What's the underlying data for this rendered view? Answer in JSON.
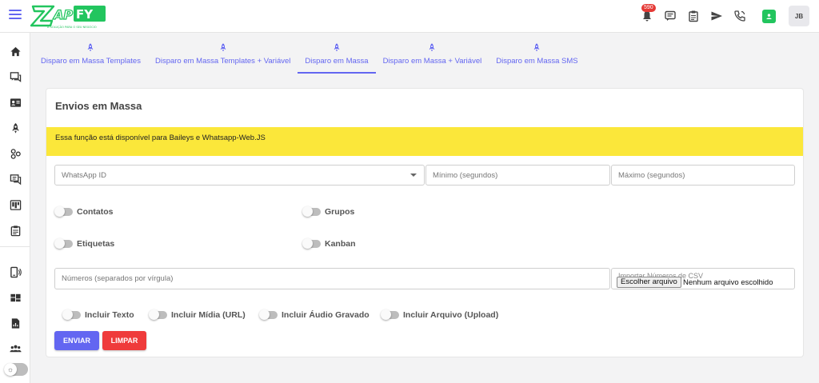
{
  "brand": {
    "logo_text": "ZAPFY",
    "logo_tagline": "A SOLUÇÃO PARA O SEU NEGÓCIO",
    "accent": "#6366f1",
    "logo_green": "#22c55e"
  },
  "topbar": {
    "notifications_count": "590",
    "icons": [
      "notifications-icon",
      "chat-icon",
      "clipboard-icon",
      "send-icon",
      "phone-icon",
      "contact-card-icon"
    ],
    "avatar_initials": "JB"
  },
  "sidebar": {
    "items": [
      "home-icon",
      "chats-icon",
      "contacts-card-icon",
      "rocket-icon",
      "connections-icon",
      "forum-icon",
      "kanban-board-icon",
      "tasks-icon",
      "phone-connect-icon",
      "dashboard-icon",
      "reports-icon",
      "users-group-icon"
    ],
    "theme_toggle_icon": "sun-icon"
  },
  "tabs": [
    {
      "label": "Disparo em Massa Templates",
      "active": false
    },
    {
      "label": "Disparo em Massa Templates + Variável",
      "active": false
    },
    {
      "label": "Disparo em Massa",
      "active": true
    },
    {
      "label": "Disparo em Massa + Variável",
      "active": false
    },
    {
      "label": "Disparo em Massa SMS",
      "active": false
    }
  ],
  "card": {
    "title": "Envios em Massa",
    "warning": "Essa função está disponível para Baileys e Whatsapp-Web.JS",
    "warning_color": "#fbe73a",
    "whatsapp_id_placeholder": "WhatsApp ID",
    "min_placeholder": "Mínimo (segundos)",
    "max_placeholder": "Máximo (segundos)",
    "toggles_row1": [
      "Contatos",
      "Grupos"
    ],
    "toggles_row2": [
      "Etiquetas",
      "Kanban"
    ],
    "numbers_placeholder": "Números (separados por vírgula)",
    "file_label": "Importar Números de CSV",
    "file_button": "Escolher arquivo",
    "file_status": "Nenhum arquivo escolhido",
    "include_toggles": [
      "Incluir Texto",
      "Incluir Mídia (URL)",
      "Incluir Áudio Gravado",
      "Incluir Arquivo (Upload)"
    ],
    "send_button": "ENVIAR",
    "clear_button": "LIMPAR",
    "send_color": "#6366f1",
    "clear_color": "#ef3b3b"
  }
}
